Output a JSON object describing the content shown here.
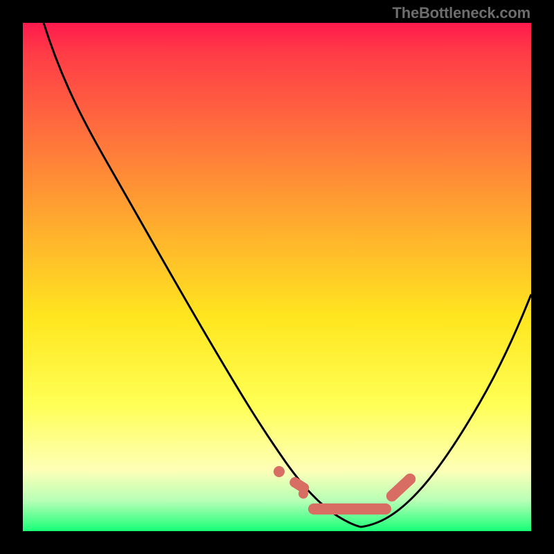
{
  "watermark": "TheBottleneck.com",
  "chart_data": {
    "type": "line",
    "title": "",
    "xlabel": "",
    "ylabel": "",
    "xlim": [
      0,
      100
    ],
    "ylim": [
      0,
      100
    ],
    "series": [
      {
        "name": "left-curve",
        "x": [
          4,
          10,
          15,
          20,
          25,
          30,
          35,
          40,
          45,
          50,
          52,
          55,
          58,
          61,
          65
        ],
        "y": [
          100,
          90,
          81,
          72,
          63,
          54,
          45,
          36,
          27,
          18,
          12,
          8,
          5,
          3,
          2
        ]
      },
      {
        "name": "right-curve",
        "x": [
          65,
          68,
          72,
          76,
          80,
          84,
          88,
          92,
          96,
          100
        ],
        "y": [
          2,
          3,
          5,
          9,
          14,
          20,
          27,
          35,
          44,
          53
        ]
      },
      {
        "name": "bottom-marker-band",
        "x": [
          49,
          51,
          53,
          56,
          59,
          62,
          65,
          68,
          70,
          72,
          74
        ],
        "y": [
          9,
          7,
          5,
          4,
          3,
          3,
          3,
          4,
          5,
          7,
          9
        ]
      }
    ],
    "colors": {
      "curve": "#000000",
      "marker": "#d86d63",
      "gradient_top": "#ff1a4d",
      "gradient_mid": "#ffe61f",
      "gradient_bottom": "#17ff77"
    }
  }
}
